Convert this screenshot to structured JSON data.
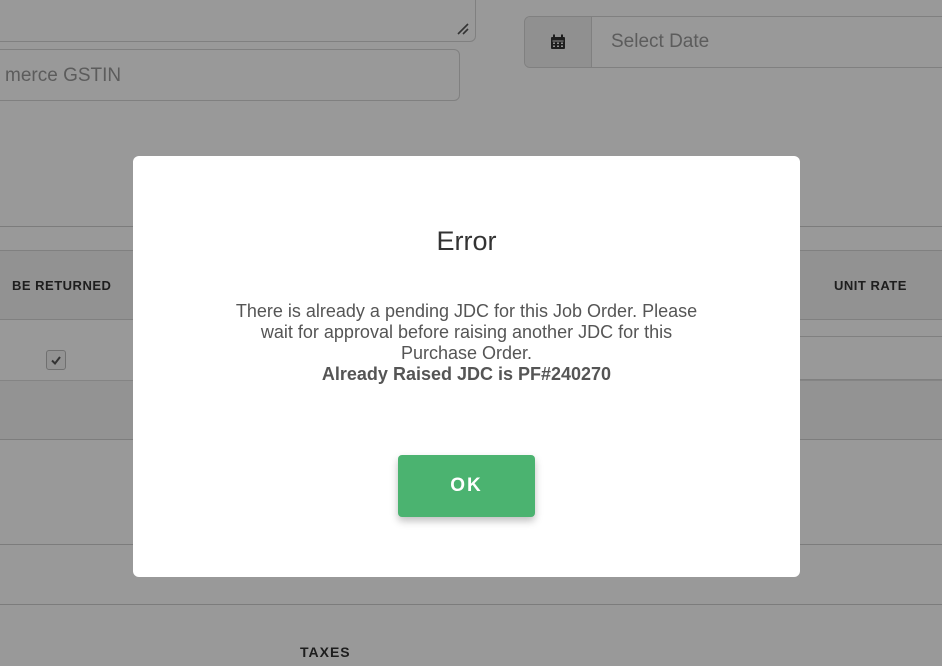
{
  "form": {
    "gstin_placeholder": "merce GSTIN",
    "date_placeholder": "Select Date",
    "icons": {
      "resize": "resize-handle-icon",
      "calendar": "calendar-icon",
      "checkbox": "checkmark-icon"
    }
  },
  "table": {
    "headers": {
      "returned": "BE RETURNED",
      "unit_rate": "UNIT RATE"
    },
    "row_checked": true
  },
  "summary": {
    "taxes_label": "TAXES"
  },
  "modal": {
    "title": "Error",
    "message_lines": [
      "There is already a pending JDC for this Job Order. Please",
      "wait for approval before raising another JDC for this",
      "Purchase Order."
    ],
    "highlight": "Already Raised JDC is PF#240270",
    "ok_label": "OK"
  },
  "colors": {
    "ok_button": "#4bb370",
    "overlay": "rgba(0,0,0,0.4)"
  }
}
